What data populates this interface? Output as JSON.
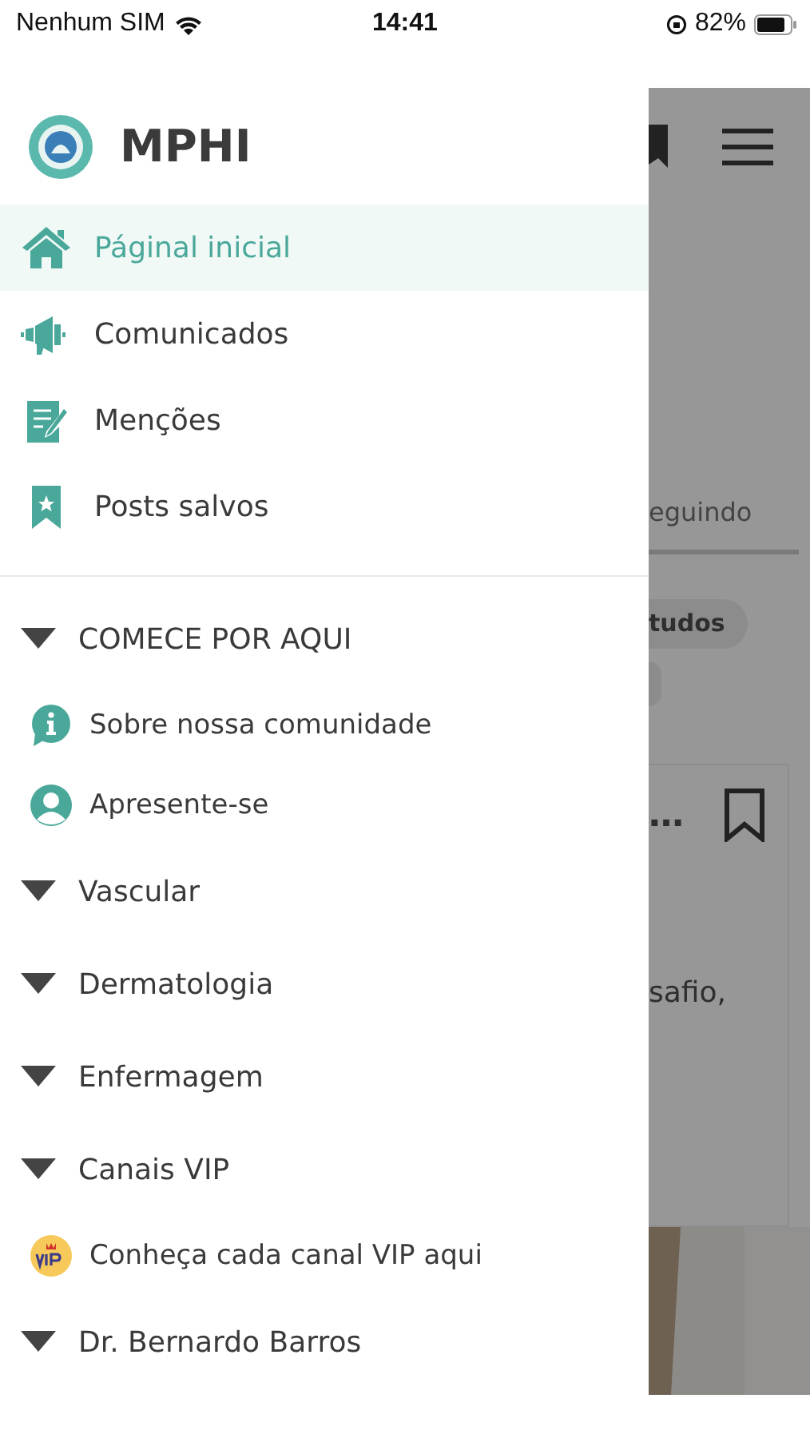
{
  "status_bar": {
    "carrier": "Nenhum SIM",
    "time": "14:41",
    "battery": "82%"
  },
  "drawer": {
    "brand": "MPHI",
    "nav_items": [
      {
        "label": "Páginal inicial",
        "selected": true
      },
      {
        "label": "Comunicados",
        "selected": false
      },
      {
        "label": "Menções",
        "selected": false
      },
      {
        "label": "Posts salvos",
        "selected": false
      }
    ],
    "sections": [
      {
        "title": "COMECE POR AQUI",
        "expanded": true,
        "items": [
          {
            "label": "Sobre nossa comunidade"
          },
          {
            "label": "Apresente-se"
          }
        ]
      },
      {
        "title": "Vascular",
        "expanded": true
      },
      {
        "title": "Dermatologia",
        "expanded": true
      },
      {
        "title": "Enfermagem",
        "expanded": true
      },
      {
        "title": "Canais VIP",
        "expanded": true,
        "items": [
          {
            "label": "Conheça cada canal VIP aqui"
          }
        ]
      },
      {
        "title": "Dr. Bernardo Barros",
        "expanded": true
      }
    ]
  },
  "background": {
    "tab": "eguindo",
    "chip": "tudos",
    "card_title": "…",
    "card_text": "safio,"
  }
}
